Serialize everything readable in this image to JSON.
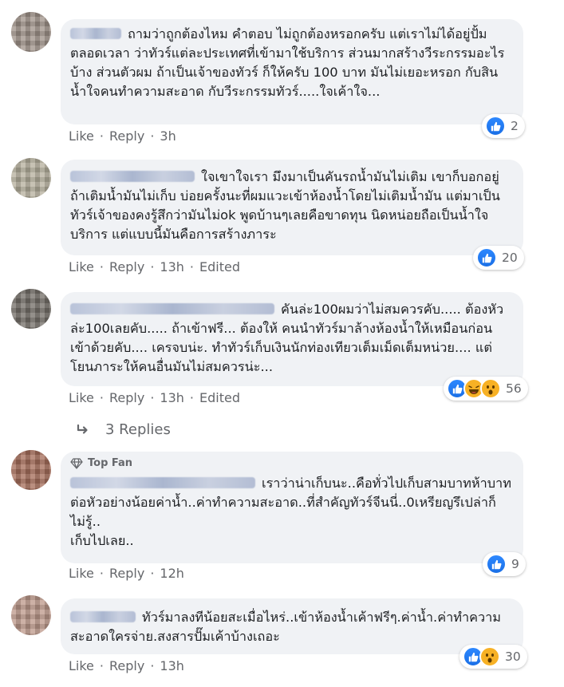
{
  "comments": [
    {
      "text": "ถามว่าถูกต้องไหม คำตอบ ไม่ถูกต้องหรอกครับ แต่เราไม่ได้อยู่ปั้มตลอดเวลา ว่าทัวร์แต่ละประเทศที่เข้ามาใช้บริการ ส่วนมากสร้างวีระกรรมอะไรบ้าง ส่วนตัวผม ถ้าเป็นเจ้าของทัวร์ ก็ให้ครับ 100 บาท มันไม่เยอะหรอก กับสินน้ำใจคนทำความสะอาด กับวีระกรรมทัวร์.....ใจเค้าใจ...",
      "like": "Like",
      "reply": "Reply",
      "time": "3h",
      "edited": "",
      "reaction_count": "2"
    },
    {
      "text": "ใจเขาใจเรา มึงมาเป็นคันรถน้ำมันไม่เติม เขาก็บอกอยู่ถ้าเติมน้ำมันไม่เก็บ บ่อยครั้งนะที่ผมแวะเข้าห้องน้ำโดยไม่เติมน้ำมัน แต่มาเป็นทัวร์เจ้าของคงรู้สึกว่ามันไม่ok พูดบ้านๆเลยคือขาดทุน นิดหน่อยถือเป็นน้ำใจบริการ แต่แบบนี้มันคือการสร้างภาระ",
      "like": "Like",
      "reply": "Reply",
      "time": "13h",
      "edited": "Edited",
      "reaction_count": "20"
    },
    {
      "text": "คันล่ะ100ผมว่าไม่สมควรคับ..... ต้องหัวล่ะ100เลยคับ..... ถ้าเข้าฟรี... ต้องให้ คนนำทัวร์มาล้างห้องน้ำให้เหมือนก่อนเข้าด้วยคับ.... เครจบน่ะ. ทำทัวร์เก็บเงินนักท่องเทียวเต็มเม็ดเต็มหน่วย.... แต่โยนภาระให้คนอื่นมันไม่สมควรน่ะ...",
      "like": "Like",
      "reply": "Reply",
      "time": "13h",
      "edited": "Edited",
      "reaction_count": "56"
    },
    {
      "badge": "Top Fan",
      "text": "เราว่าน่าเก็บนะ..คือทั่วไปเก็บสามบาทห้าบาทต่อหัวอย่างน้อยค่าน้ำ..ค่าทำความสะอาด..ที่สำคัญทัวร์จีนนี่..0เหรียญรึเปล่าก็ไม่รู้..\nเก็บไปเลย..",
      "like": "Like",
      "reply": "Reply",
      "time": "12h",
      "edited": "",
      "reaction_count": "9"
    },
    {
      "text": "ทัวร์มาลงทีน้อยสะเมื่อไหร่..เข้าห้องน้ำเค้าฟรีๆ.ค่าน้ำ.ค่าทำความสะอาดใครจ่าย.สงสารปั๊มเค้าบ้างเถอะ",
      "like": "Like",
      "reply": "Reply",
      "time": "13h",
      "edited": "",
      "reaction_count": "30"
    }
  ],
  "replies_link": "3 Replies",
  "colors": {
    "like_blue": "#1877f2",
    "meta_gray": "#65676b",
    "bubble": "#f0f2f5"
  }
}
